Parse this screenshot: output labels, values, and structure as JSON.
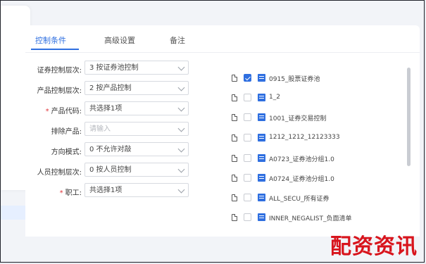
{
  "tabs": [
    {
      "label": "控制条件",
      "active": true
    },
    {
      "label": "高级设置",
      "active": false
    },
    {
      "label": "备注",
      "active": false
    }
  ],
  "form": {
    "fields": [
      {
        "label": "证券控制层次:",
        "required": false,
        "value": "3 按证券池控制",
        "placeholder": ""
      },
      {
        "label": "产品控制层次:",
        "required": false,
        "value": "2 按产品控制",
        "placeholder": ""
      },
      {
        "label": "产品代码:",
        "required": true,
        "value": "共选择1项",
        "placeholder": ""
      },
      {
        "label": "排除产品:",
        "required": false,
        "value": "",
        "placeholder": "请输入"
      },
      {
        "label": "方向模式:",
        "required": false,
        "value": "0 不允许对敲",
        "placeholder": ""
      },
      {
        "label": "人员控制层次:",
        "required": false,
        "value": "0 按人员控制",
        "placeholder": ""
      },
      {
        "label": "职工:",
        "required": true,
        "value": "共选择1项",
        "placeholder": ""
      }
    ]
  },
  "list": {
    "items": [
      {
        "label": "0915_股票证券池",
        "checked": true
      },
      {
        "label": "1_2",
        "checked": false
      },
      {
        "label": "1001_证券交易控制",
        "checked": false
      },
      {
        "label": "1212_1212_12123333",
        "checked": false
      },
      {
        "label": "A0723_证券池分组1.0",
        "checked": false
      },
      {
        "label": "A0724_证券池分组1.0",
        "checked": false
      },
      {
        "label": "ALL_SECU_所有证券",
        "checked": false
      },
      {
        "label": "INNER_NEGALIST_负面清单",
        "checked": false
      }
    ]
  },
  "watermark": "配资资讯",
  "colors": {
    "accent": "#2f6fe0",
    "required": "#e0343a",
    "watermark": "#d8141c"
  }
}
